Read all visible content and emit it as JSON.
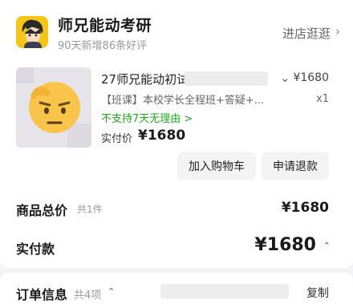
{
  "shop": {
    "name": "师兄能动考研",
    "subtitle": "90天新增86条好评",
    "visit_label": "进店逛逛",
    "visit_chevron": "›"
  },
  "product": {
    "title": "27师兄能动初试",
    "dropdown_chevron": "⌄",
    "price": "¥1680",
    "tag": "【班课】本校学长全程班+答疑+...",
    "quantity": "x1",
    "return_policy": "不支持7天无理由 >",
    "paid_label": "实付价",
    "paid_value": "¥1680"
  },
  "actions": {
    "add_cart": "加入购物车",
    "refund": "申请退款"
  },
  "summary": {
    "total_label": "商品总价",
    "total_count": "共1件",
    "total_value": "¥1680",
    "final_label": "实付款",
    "final_value": "¥1680",
    "final_chevron": "⌃"
  },
  "order_info": {
    "title": "订单信息",
    "count": "共4项",
    "chevron": "⌃",
    "copy_label": "复制"
  },
  "colors": {
    "green": "#1aad19",
    "logo_bg": "#f5c518"
  }
}
